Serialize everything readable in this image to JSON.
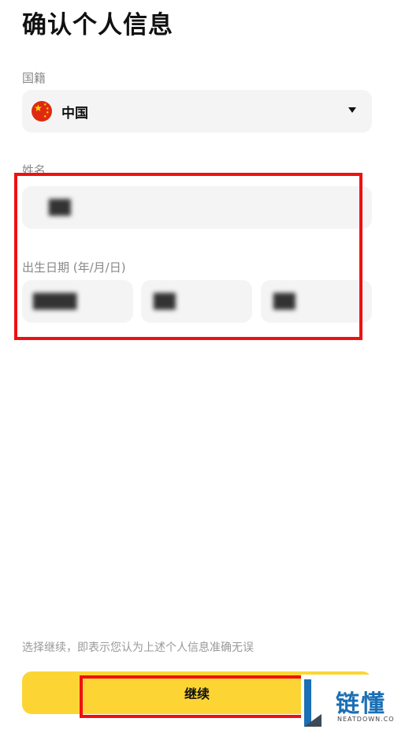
{
  "page": {
    "title": "确认个人信息",
    "nationality_label": "国籍",
    "nationality_value": "中国",
    "name_label": "姓名",
    "name_value": "██",
    "dob_label": "出生日期 (年/月/日)",
    "dob_year": "████",
    "dob_month": "██",
    "dob_day": "██",
    "disclaimer": "选择继续，即表示您认为上述个人信息准确无误",
    "continue_label": "继续"
  },
  "watermark": {
    "text": "链懂",
    "sub": "NEATDOWN.COM"
  },
  "colors": {
    "accent": "#fcd535",
    "highlight": "#ee1111",
    "field_bg": "#f4f4f4",
    "label": "#888888"
  },
  "icons": {
    "flag": "china-flag-icon",
    "dropdown": "chevron-down-icon"
  }
}
